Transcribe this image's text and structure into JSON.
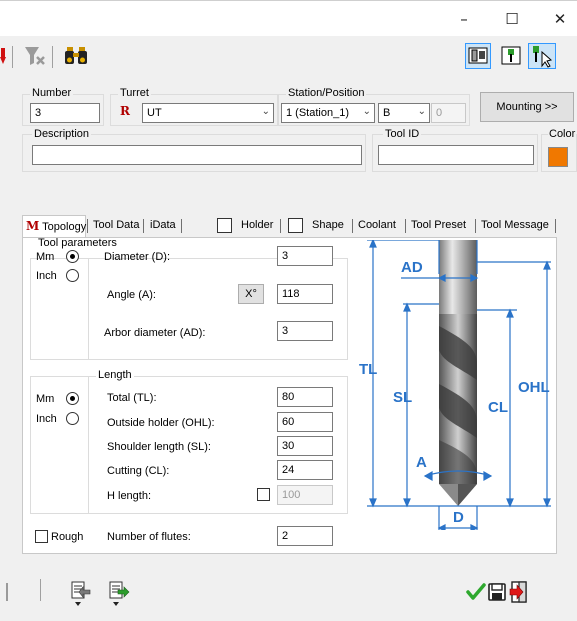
{
  "window": {
    "minimize": "–",
    "maximize": "☐",
    "close": "✕"
  },
  "toolbar": {
    "left_icons": [
      "arrow-down-icon",
      "filter-clear-icon",
      "binoculars-icon"
    ],
    "right_icons": [
      "tool-view-icon",
      "tool-green-icon",
      "tool-pointer-icon"
    ]
  },
  "header": {
    "number_label": "Number",
    "number_value": "3",
    "turret_label": "Turret",
    "turret_prefix": "R",
    "turret_value": "UT",
    "station_label": "Station/Position",
    "station_value": "1 (Station_1)",
    "position_value": "B",
    "position_index": "0",
    "mounting_button": "Mounting >>",
    "description_label": "Description",
    "description_value": "",
    "toolid_label": "Tool ID",
    "toolid_value": "",
    "color_label": "Color",
    "color_value": "#f07800"
  },
  "tabs": {
    "topology_icon": "M",
    "topology": "Topology",
    "tooldata": "Tool Data",
    "idata": "iData",
    "holder": "Holder",
    "shape": "Shape",
    "coolant": "Coolant",
    "toolpreset": "Tool Preset",
    "toolmessage": "Tool Message"
  },
  "tool_parameters": {
    "title": "Tool parameters",
    "unit_mm": "Mm",
    "unit_inch": "Inch",
    "diameter_label": "Diameter (D):",
    "diameter_value": "3",
    "angle_label": "Angle (A):",
    "angle_button": "X°",
    "angle_value": "118",
    "arbor_label": "Arbor diameter (AD):",
    "arbor_value": "3"
  },
  "length": {
    "title": "Length",
    "unit_mm": "Mm",
    "unit_inch": "Inch",
    "total_label": "Total (TL):",
    "total_value": "80",
    "ohl_label": "Outside holder (OHL):",
    "ohl_value": "60",
    "shoulder_label": "Shoulder length (SL):",
    "shoulder_value": "30",
    "cutting_label": "Cutting (CL):",
    "cutting_value": "24",
    "hlength_label": "H length:",
    "hlength_value": "100"
  },
  "flutes": {
    "rough_label": "Rough",
    "flutes_label": "Number of flutes:",
    "flutes_value": "2"
  },
  "diagram": {
    "ad": "AD",
    "tl": "TL",
    "sl": "SL",
    "ohl": "OHL",
    "cl": "CL",
    "a": "A",
    "d": "D"
  },
  "bottom": {
    "left_icons": [
      "import-icon",
      "export-icon"
    ],
    "right_icons": [
      "ok-check-icon",
      "save-icon",
      "exit-icon"
    ]
  }
}
